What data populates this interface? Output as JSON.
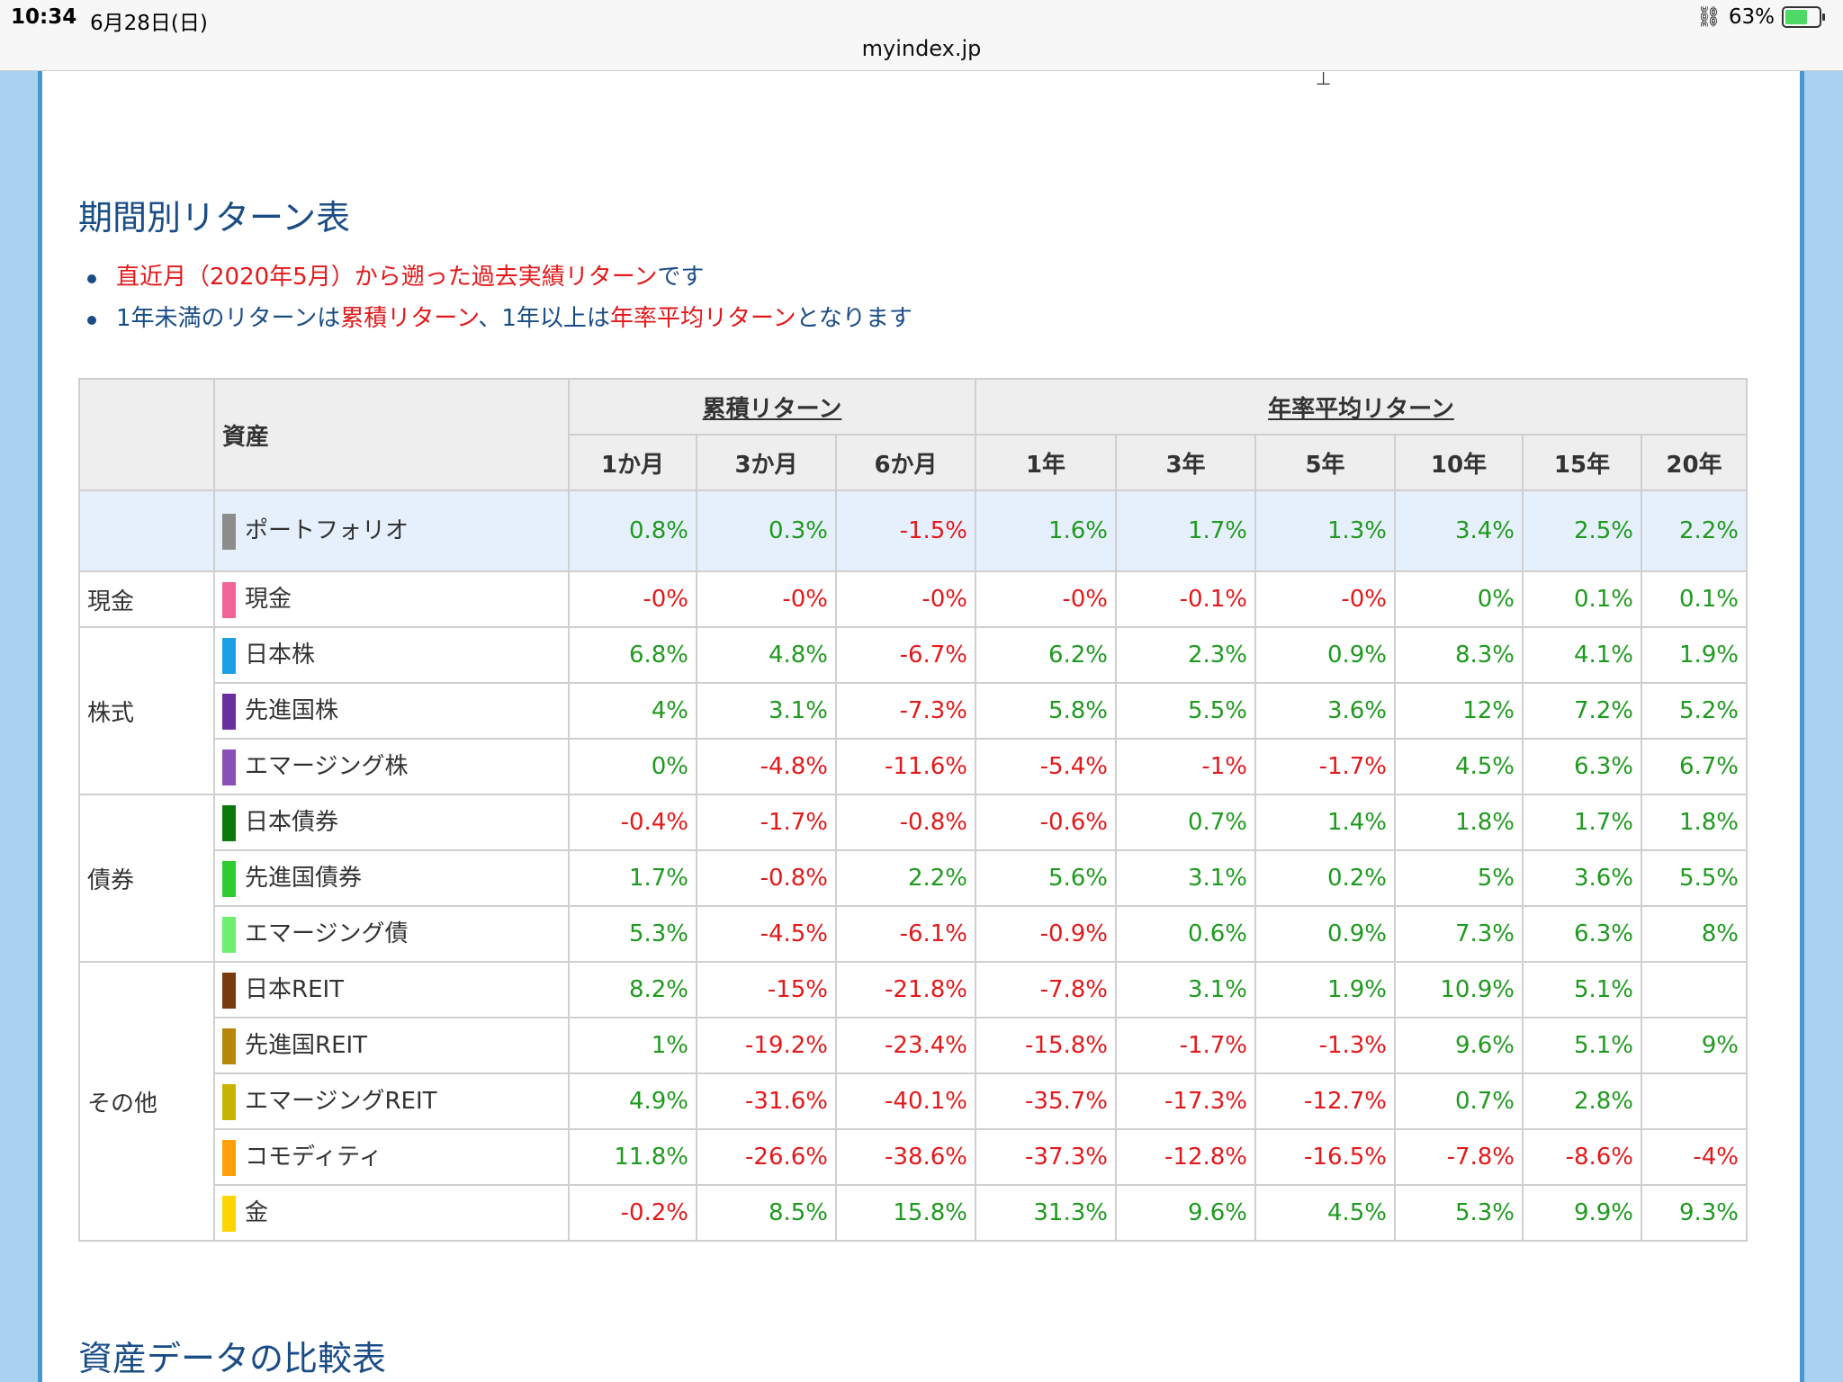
{
  "status": {
    "time": "10:34",
    "date": "6月28日(日)",
    "url": "myindex.jp",
    "battery": "63%"
  },
  "section1": {
    "title": "期間別リターン表",
    "bullet1": {
      "red": "直近月（2020年5月）から遡った過去実績リターン",
      "rest": "です"
    },
    "bullet2": {
      "a": "1年未満のリターンは",
      "b": "累積リターン",
      "c": "、1年以上は",
      "d": "年率平均リターン",
      "e": "となります"
    }
  },
  "table": {
    "asset_header": "資産",
    "group1": "累積リターン",
    "group2": "年率平均リターン",
    "periods": [
      "1か月",
      "3か月",
      "6か月",
      "1年",
      "3年",
      "5年",
      "10年",
      "15年",
      "20年"
    ],
    "rows": [
      {
        "category": "",
        "asset": "ポートフォリオ",
        "color": "#8c8c8c",
        "portfolio": true,
        "values": [
          "0.8%",
          "0.3%",
          "-1.5%",
          "1.6%",
          "1.7%",
          "1.3%",
          "3.4%",
          "2.5%",
          "2.2%"
        ]
      },
      {
        "category": "現金",
        "span": 1,
        "asset": "現金",
        "color": "#f06496",
        "values": [
          "-0%",
          "-0%",
          "-0%",
          "-0%",
          "-0.1%",
          "-0%",
          "0%",
          "0.1%",
          "0.1%"
        ]
      },
      {
        "category": "株式",
        "span": 3,
        "asset": "日本株",
        "color": "#1aa0e6",
        "values": [
          "6.8%",
          "4.8%",
          "-6.7%",
          "6.2%",
          "2.3%",
          "0.9%",
          "8.3%",
          "4.1%",
          "1.9%"
        ]
      },
      {
        "asset": "先進国株",
        "color": "#6a2ea0",
        "values": [
          "4%",
          "3.1%",
          "-7.3%",
          "5.8%",
          "5.5%",
          "3.6%",
          "12%",
          "7.2%",
          "5.2%"
        ]
      },
      {
        "asset": "エマージング株",
        "color": "#8b50b8",
        "values": [
          "0%",
          "-4.8%",
          "-11.6%",
          "-5.4%",
          "-1%",
          "-1.7%",
          "4.5%",
          "6.3%",
          "6.7%"
        ]
      },
      {
        "category": "債券",
        "span": 3,
        "asset": "日本債券",
        "color": "#0a7a0a",
        "values": [
          "-0.4%",
          "-1.7%",
          "-0.8%",
          "-0.6%",
          "0.7%",
          "1.4%",
          "1.8%",
          "1.7%",
          "1.8%"
        ]
      },
      {
        "asset": "先進国債券",
        "color": "#2ecc2e",
        "values": [
          "1.7%",
          "-0.8%",
          "2.2%",
          "5.6%",
          "3.1%",
          "0.2%",
          "5%",
          "3.6%",
          "5.5%"
        ]
      },
      {
        "asset": "エマージング債",
        "color": "#6ef06e",
        "values": [
          "5.3%",
          "-4.5%",
          "-6.1%",
          "-0.9%",
          "0.6%",
          "0.9%",
          "7.3%",
          "6.3%",
          "8%"
        ]
      },
      {
        "category": "その他",
        "span": 5,
        "asset": "日本REIT",
        "color": "#7a3a10",
        "values": [
          "8.2%",
          "-15%",
          "-21.8%",
          "-7.8%",
          "3.1%",
          "1.9%",
          "10.9%",
          "5.1%",
          ""
        ]
      },
      {
        "asset": "先進国REIT",
        "color": "#b8860b",
        "values": [
          "1%",
          "-19.2%",
          "-23.4%",
          "-15.8%",
          "-1.7%",
          "-1.3%",
          "9.6%",
          "5.1%",
          "9%"
        ]
      },
      {
        "asset": "エマージングREIT",
        "color": "#c8b400",
        "values": [
          "4.9%",
          "-31.6%",
          "-40.1%",
          "-35.7%",
          "-17.3%",
          "-12.7%",
          "0.7%",
          "2.8%",
          ""
        ]
      },
      {
        "asset": "コモディティ",
        "color": "#ff9f0a",
        "values": [
          "11.8%",
          "-26.6%",
          "-38.6%",
          "-37.3%",
          "-12.8%",
          "-16.5%",
          "-7.8%",
          "-8.6%",
          "-4%"
        ]
      },
      {
        "asset": "金",
        "color": "#ffd400",
        "values": [
          "-0.2%",
          "8.5%",
          "15.8%",
          "31.3%",
          "9.6%",
          "4.5%",
          "5.3%",
          "9.9%",
          "9.3%"
        ]
      }
    ]
  },
  "section2": {
    "title": "資産データの比較表"
  },
  "colors": {
    "positive": "#1f9a1f",
    "negative": "#e2191a",
    "heading": "#1a4d86",
    "frame": "#4a98d0"
  }
}
